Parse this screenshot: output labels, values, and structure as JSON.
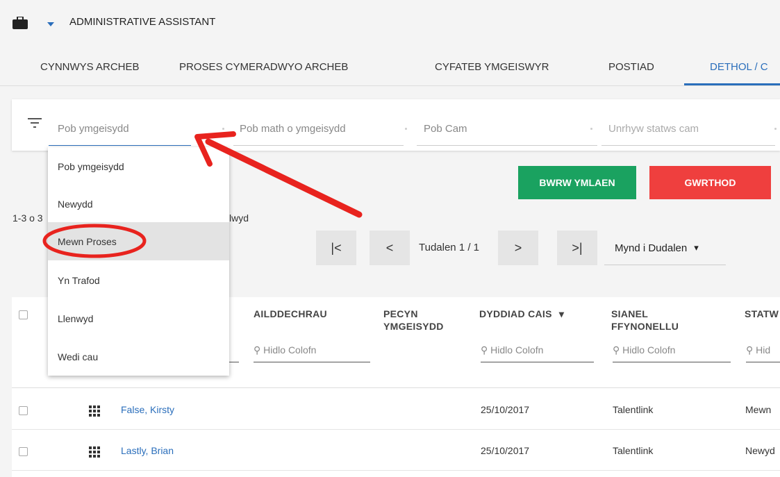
{
  "header": {
    "title": "ADMINISTRATIVE ASSISTANT",
    "icon": "briefcase-icon"
  },
  "tabs": [
    {
      "label": "CYNNWYS ARCHEB"
    },
    {
      "label": "PROSES CYMERADWYO ARCHEB"
    },
    {
      "label": "CYFATEB YMGEISWYR"
    },
    {
      "label": "POSTIAD"
    },
    {
      "label": "DETHOL / C",
      "active": true
    }
  ],
  "filters": {
    "applicant": "Pob ymgeisydd",
    "applicant_type": "Pob math o ymgeisydd",
    "stage": "Pob Cam",
    "stage_status": "Unrhyw statws cam"
  },
  "dropdown": {
    "items": [
      "Pob ymgeisydd",
      "Newydd",
      "Mewn Proses",
      "Yn Trafod",
      "Llenwyd",
      "Wedi cau"
    ],
    "highlighted": "Mewn Proses"
  },
  "actions": {
    "continue": "BWRW YMLAEN",
    "reject": "GWRTHOD"
  },
  "records": {
    "count_prefix": "1-3 o 3",
    "tail": "lwyd"
  },
  "pagination": {
    "first": "|<",
    "prev": "<",
    "next": ">",
    "last": ">|",
    "page_label": "Tudalen 1 / 1",
    "goto_label": "Mynd i Dudalen",
    "goto_caret": "▾"
  },
  "table": {
    "columns": [
      {
        "label": "AILDDECHRAU"
      },
      {
        "label": "PECYN YMGEISYDD"
      },
      {
        "label": "DYDDIAD CAIS",
        "sort": "▾"
      },
      {
        "label": "SIANEL FFYNONELLU"
      },
      {
        "label": "STATW"
      }
    ],
    "filter_placeholder": "Hidlo Colofn",
    "filter_partial": "Hid",
    "rows": [
      {
        "name": "False, Kirsty",
        "date": "25/10/2017",
        "channel": "Talentlink",
        "status": "Mewn"
      },
      {
        "name": "Lastly, Brian",
        "date": "25/10/2017",
        "channel": "Talentlink",
        "status": "Newyd"
      }
    ]
  },
  "colors": {
    "accent": "#2a6ebb",
    "continue": "#1aa260",
    "reject": "#ef3f3e",
    "annotation": "#e8231e"
  }
}
